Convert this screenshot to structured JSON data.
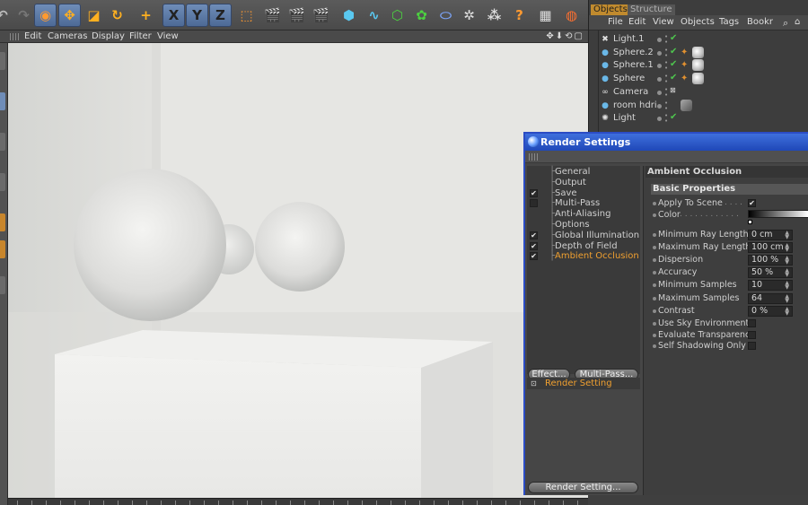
{
  "toolbar": {
    "tools": [
      {
        "name": "undo-icon",
        "glyph": "↶"
      },
      {
        "name": "redo-icon",
        "glyph": "↷"
      },
      {
        "name": "live-select-icon",
        "glyph": "◉"
      },
      {
        "name": "move-icon",
        "glyph": "✥"
      },
      {
        "name": "scale-icon",
        "glyph": "◪"
      },
      {
        "name": "rotate-icon",
        "glyph": "↻"
      },
      {
        "name": "add-icon",
        "glyph": "+"
      },
      {
        "name": "x-axis-icon",
        "glyph": "X"
      },
      {
        "name": "y-axis-icon",
        "glyph": "Y"
      },
      {
        "name": "z-axis-icon",
        "glyph": "Z"
      },
      {
        "name": "coordinate-system-icon",
        "glyph": "⬚"
      },
      {
        "name": "render-view-icon",
        "glyph": "🎬"
      },
      {
        "name": "render-picture-viewer-icon",
        "glyph": "🎬"
      },
      {
        "name": "render-settings-icon",
        "glyph": "🎬"
      },
      {
        "name": "cube-icon",
        "glyph": "⬢"
      },
      {
        "name": "spline-icon",
        "glyph": "∿"
      },
      {
        "name": "nurbs-icon",
        "glyph": "⬡"
      },
      {
        "name": "array-icon",
        "glyph": "✿"
      },
      {
        "name": "deformer-icon",
        "glyph": "⬭"
      },
      {
        "name": "scene-icon",
        "glyph": "✲"
      },
      {
        "name": "particle-icon",
        "glyph": "⁂"
      },
      {
        "name": "help-icon",
        "glyph": "?"
      },
      {
        "name": "layout-icon",
        "glyph": "▦"
      },
      {
        "name": "content-browser-icon",
        "glyph": "◍"
      }
    ]
  },
  "viewport_menu": {
    "items": [
      "Edit",
      "Cameras",
      "Display",
      "Filter",
      "View"
    ],
    "nav_icons": "✥⬇⟲▢"
  },
  "objects_panel": {
    "tabs": [
      "Objects",
      "Structure"
    ],
    "menu": [
      "File",
      "Edit",
      "View",
      "Objects",
      "Tags",
      "Bookr"
    ],
    "rows": [
      {
        "icon": "light-icon",
        "glyph": "✖",
        "name": "Light.1",
        "check": true,
        "tags": false
      },
      {
        "icon": "sphere-icon",
        "glyph": "●",
        "name": "Sphere.2",
        "check": true,
        "tags": true
      },
      {
        "icon": "sphere-icon",
        "glyph": "●",
        "name": "Sphere.1",
        "check": true,
        "tags": true
      },
      {
        "icon": "sphere-icon",
        "glyph": "●",
        "name": "Sphere",
        "check": true,
        "tags": true
      },
      {
        "icon": "camera-icon",
        "glyph": "∞",
        "name": "Camera",
        "check": false,
        "tags": false
      },
      {
        "icon": "sky-icon",
        "glyph": "●",
        "name": "room hdri",
        "check": false,
        "tags": false
      },
      {
        "icon": "light-icon",
        "glyph": "✺",
        "name": "Light",
        "check": true,
        "tags": false
      }
    ]
  },
  "render_settings": {
    "title": "Render Settings",
    "nav": [
      {
        "label": "General",
        "check": false,
        "box": false
      },
      {
        "label": "Output",
        "check": false,
        "box": false
      },
      {
        "label": "Save",
        "check": true,
        "box": true
      },
      {
        "label": "Multi-Pass",
        "check": false,
        "box": true
      },
      {
        "label": "Anti-Aliasing",
        "check": false,
        "box": false
      },
      {
        "label": "Options",
        "check": false,
        "box": false
      },
      {
        "label": "Global Illumination",
        "check": true,
        "box": true
      },
      {
        "label": "Depth of Field",
        "check": true,
        "box": true
      },
      {
        "label": "Ambient Occlusion",
        "check": true,
        "box": true,
        "active": true
      }
    ],
    "effect_button": "Effect...",
    "multipass_button": "Multi-Pass...",
    "render_setting_item": "Render Setting",
    "render_setting_button": "Render Setting...",
    "section_title": "Ambient Occlusion",
    "group_title": "Basic Properties",
    "apply_to_scene": {
      "label": "Apply To Scene",
      "checked": true
    },
    "color": {
      "label": "Color"
    },
    "fields": [
      {
        "label": "Minimum Ray Length",
        "value": "0 cm"
      },
      {
        "label": "Maximum Ray Length",
        "value": "100 cm"
      },
      {
        "label": "Dispersion",
        "value": "100 %"
      },
      {
        "label": "Accuracy",
        "value": "50 %"
      },
      {
        "label": "Minimum Samples",
        "value": "10"
      },
      {
        "label": "Maximum Samples",
        "value": "64"
      },
      {
        "label": "Contrast",
        "value": "0 %"
      }
    ],
    "options": [
      {
        "label": "Use Sky Environment",
        "checked": false
      },
      {
        "label": "Evaluate Transparency",
        "checked": false
      },
      {
        "label": "Self Shadowing Only",
        "checked": false
      }
    ]
  }
}
